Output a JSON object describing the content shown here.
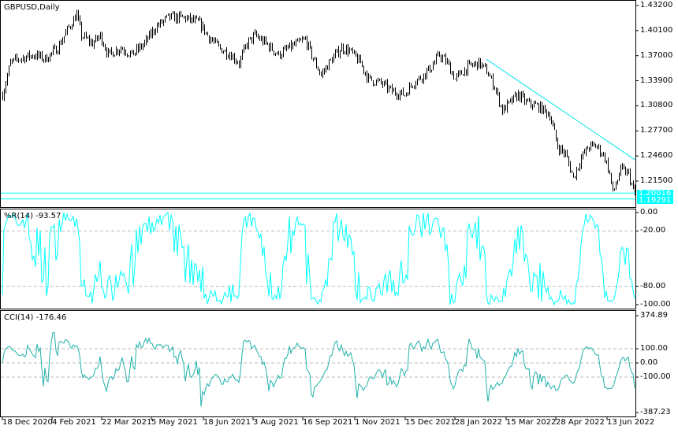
{
  "chart_data": [
    {
      "type": "ohlc",
      "title": "GBPUSD,Daily",
      "symbol": "GBPUSD",
      "timeframe": "Daily",
      "ylim": [
        1.189,
        1.436
      ],
      "y_ticks": [
        "1.43200",
        "1.40100",
        "1.37000",
        "1.33900",
        "1.30800",
        "1.27700",
        "1.24600",
        "1.21500"
      ],
      "price_tags": [
        "1.20016",
        "1.19291"
      ],
      "horizontal_levels": [
        1.20016,
        1.19291
      ],
      "trendline": {
        "from": [
          307,
          1.3655
        ],
        "to": [
          403,
          1.241
        ]
      },
      "bars_count": 402,
      "close_anchors": [
        [
          0,
          1.322
        ],
        [
          5,
          1.361
        ],
        [
          10,
          1.366
        ],
        [
          20,
          1.371
        ],
        [
          27,
          1.366
        ],
        [
          35,
          1.38
        ],
        [
          42,
          1.405
        ],
        [
          47,
          1.421
        ],
        [
          50,
          1.395
        ],
        [
          57,
          1.385
        ],
        [
          62,
          1.395
        ],
        [
          67,
          1.371
        ],
        [
          75,
          1.38
        ],
        [
          82,
          1.371
        ],
        [
          90,
          1.385
        ],
        [
          97,
          1.405
        ],
        [
          105,
          1.417
        ],
        [
          115,
          1.417
        ],
        [
          125,
          1.41
        ],
        [
          130,
          1.395
        ],
        [
          137,
          1.38
        ],
        [
          145,
          1.371
        ],
        [
          150,
          1.361
        ],
        [
          155,
          1.385
        ],
        [
          160,
          1.395
        ],
        [
          167,
          1.385
        ],
        [
          175,
          1.371
        ],
        [
          182,
          1.38
        ],
        [
          187,
          1.385
        ],
        [
          192,
          1.39
        ],
        [
          197,
          1.366
        ],
        [
          202,
          1.346
        ],
        [
          207,
          1.361
        ],
        [
          215,
          1.38
        ],
        [
          220,
          1.376
        ],
        [
          227,
          1.361
        ],
        [
          232,
          1.341
        ],
        [
          240,
          1.336
        ],
        [
          247,
          1.326
        ],
        [
          255,
          1.322
        ],
        [
          260,
          1.336
        ],
        [
          267,
          1.346
        ],
        [
          272,
          1.356
        ],
        [
          277,
          1.371
        ],
        [
          282,
          1.361
        ],
        [
          287,
          1.341
        ],
        [
          295,
          1.356
        ],
        [
          302,
          1.361
        ],
        [
          307,
          1.351
        ],
        [
          312,
          1.332
        ],
        [
          317,
          1.302
        ],
        [
          322,
          1.312
        ],
        [
          327,
          1.322
        ],
        [
          332,
          1.312
        ],
        [
          340,
          1.307
        ],
        [
          347,
          1.297
        ],
        [
          352,
          1.258
        ],
        [
          357,
          1.248
        ],
        [
          362,
          1.219
        ],
        [
          367,
          1.244
        ],
        [
          372,
          1.258
        ],
        [
          377,
          1.258
        ],
        [
          382,
          1.244
        ],
        [
          385,
          1.224
        ],
        [
          387,
          1.2
        ],
        [
          392,
          1.229
        ],
        [
          397,
          1.224
        ],
        [
          401,
          1.197
        ]
      ],
      "x_ticks": [
        "18 Dec 2020",
        "4 Feb 2021",
        "22 Mar 2021",
        "5 May 2021",
        "18 Jun 2021",
        "3 Aug 2021",
        "16 Sep 2021",
        "1 Nov 2021",
        "15 Dec 2021",
        "28 Jan 2022",
        "15 Mar 2022",
        "28 Apr 2022",
        "13 Jun 2022"
      ],
      "colors": {
        "bars": "#000000",
        "levels": "#00ffff",
        "trendline": "#00e5ee"
      }
    },
    {
      "type": "line",
      "title": "%R(14) -93.57",
      "indicator": "Williams %R",
      "period": 14,
      "last_value": -93.57,
      "ylim": [
        -100,
        0
      ],
      "y_ticks": [
        "0.00",
        "-20.00",
        "-80.00",
        "-100.00"
      ],
      "levels": [
        -20,
        -80
      ],
      "color": "#00ffff"
    },
    {
      "type": "line",
      "title": "CCI(14) -176.46",
      "indicator": "Commodity Channel Index",
      "period": 14,
      "last_value": -176.46,
      "ylim": [
        -387.23,
        374.89
      ],
      "y_ticks": [
        "374.89",
        "100.00",
        "0.00",
        "-100.00",
        "-387.23"
      ],
      "levels": [
        100,
        0,
        -100
      ],
      "color": "#20b2aa"
    }
  ]
}
